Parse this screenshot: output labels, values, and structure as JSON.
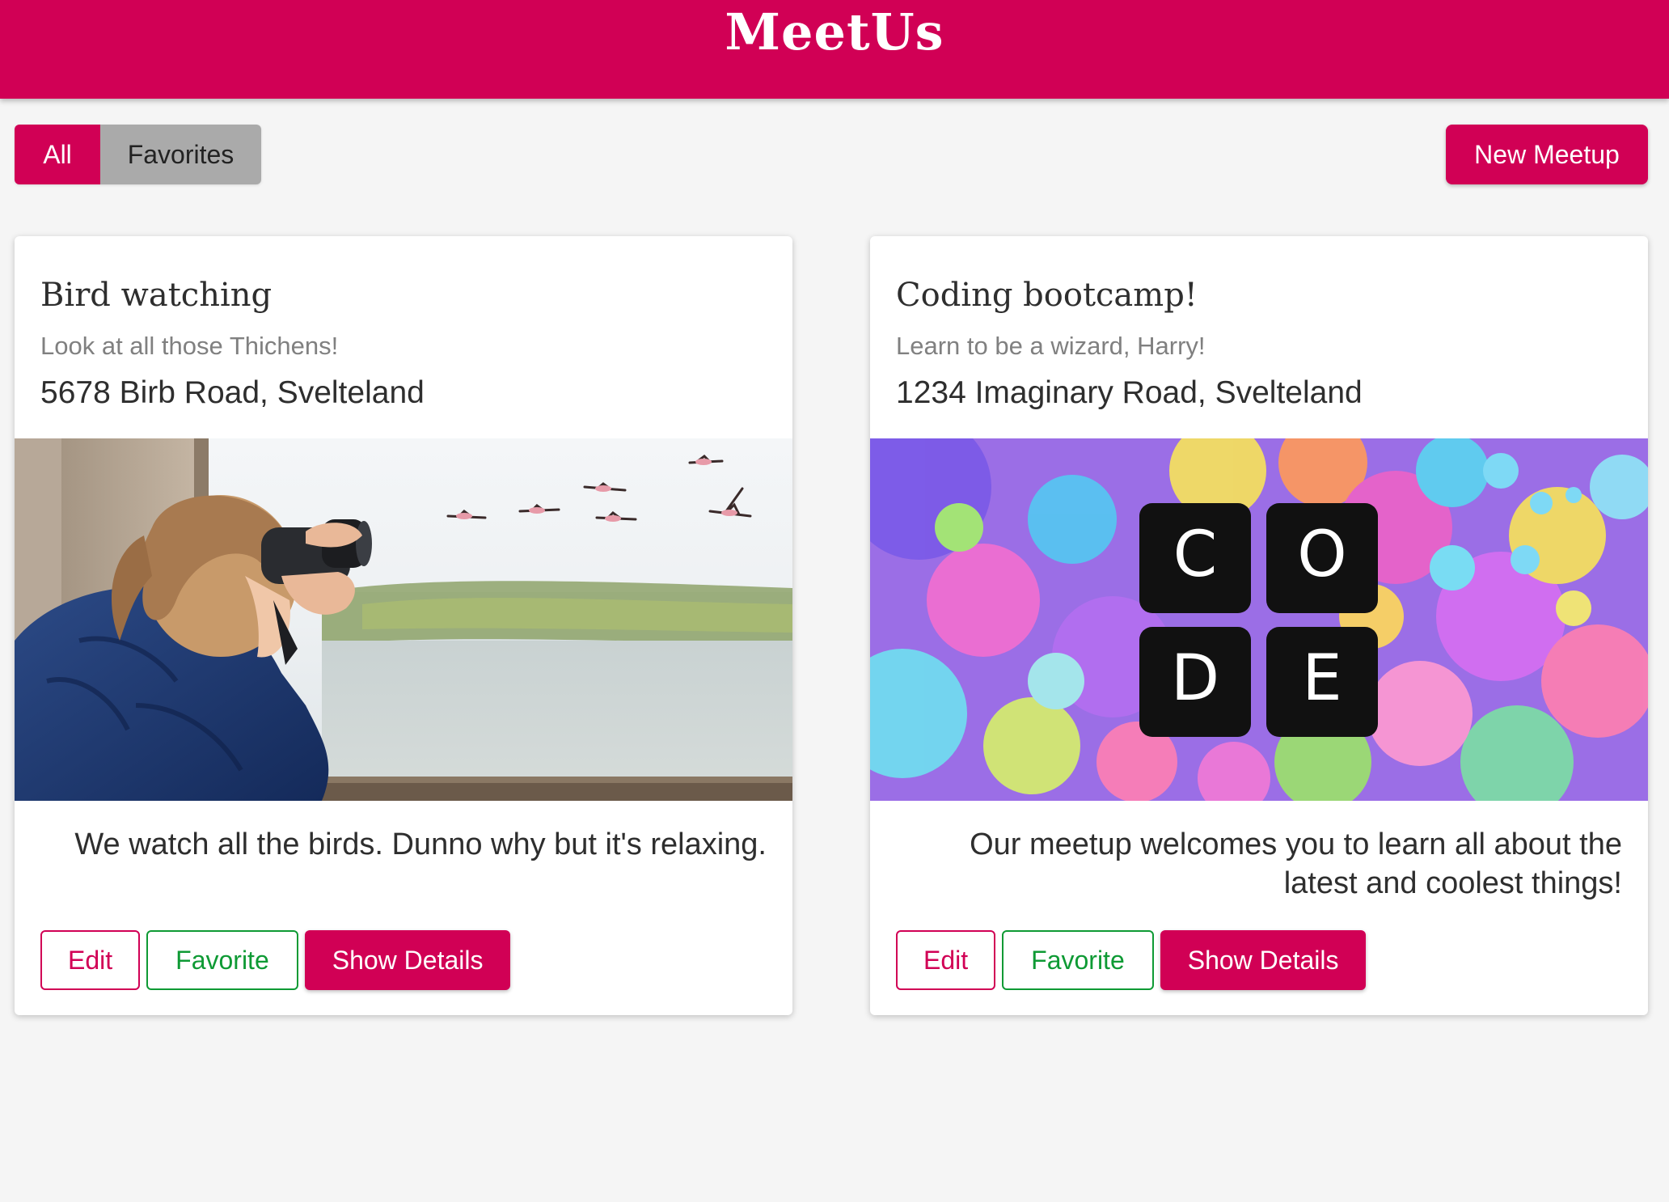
{
  "header": {
    "title": "MeetUs"
  },
  "filters": {
    "all_label": "All",
    "favorites_label": "Favorites",
    "active": "All"
  },
  "toolbar": {
    "new_meetup_label": "New Meetup"
  },
  "meetups": [
    {
      "title": "Bird watching",
      "subtitle": "Look at all those Thichens!",
      "address": "5678 Birb Road, Svelteland",
      "image": "girl-with-binoculars-and-flamingos",
      "description": "We watch all the birds. Dunno why but it's relaxing.",
      "edit_label": "Edit",
      "favorite_label": "Favorite",
      "details_label": "Show Details"
    },
    {
      "title": "Coding bootcamp!",
      "subtitle": "Learn to be a wizard, Harry!",
      "address": "1234 Imaginary Road, Svelteland",
      "image": "colorful-paint-splatter-code-logo",
      "code_letters": [
        "C",
        "O",
        "D",
        "E"
      ],
      "description": "Our meetup welcomes you to learn all about the latest and coolest things!",
      "edit_label": "Edit",
      "favorite_label": "Favorite",
      "details_label": "Show Details"
    }
  ],
  "colors": {
    "brand": "#d10055",
    "favorite": "#0e9a34",
    "inactive_filter": "#aaaaaa",
    "background": "#f5f5f5"
  }
}
